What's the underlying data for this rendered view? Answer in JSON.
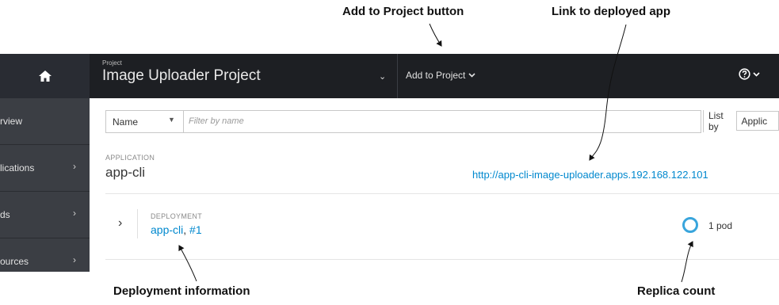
{
  "callouts": {
    "add_to_project": "Add to Project button",
    "deployed_link": "Link to deployed app",
    "deployment_info": "Deployment information",
    "replica_count": "Replica count"
  },
  "header": {
    "project_label": "Project",
    "project_name": "Image Uploader Project",
    "add_to_project": "Add to Project"
  },
  "sidebar": {
    "items": [
      {
        "label": "rview"
      },
      {
        "label": "lications"
      },
      {
        "label": "ds"
      },
      {
        "label": "ources"
      }
    ]
  },
  "filter": {
    "select_value": "Name",
    "placeholder": "Filter by name",
    "list_by_label": "List by",
    "list_by_value": "Applic"
  },
  "application": {
    "section_label": "APPLICATION",
    "name": "app-cli",
    "route_url": "http://app-cli-image-uploader.apps.192.168.122.101"
  },
  "deployment": {
    "section_label": "DEPLOYMENT",
    "name": "app-cli",
    "separator": ", ",
    "version": "#1",
    "pods": "1 pod"
  },
  "icons": [
    "home-icon",
    "chevron-down-icon",
    "help-icon",
    "chevron-right-icon",
    "pod-donut-icon"
  ],
  "colors": {
    "topbar": "#1d1f23",
    "sidebar": "#3b3e44",
    "link": "#0088ce",
    "donut": "#39a5dc"
  }
}
